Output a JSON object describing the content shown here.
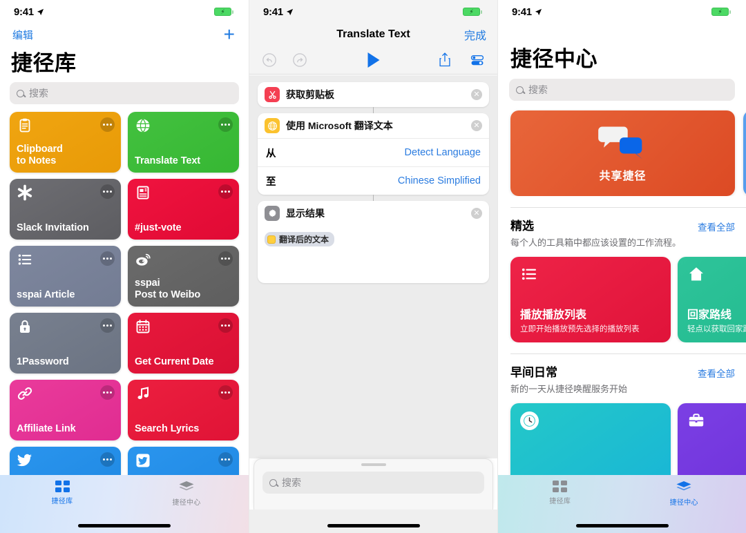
{
  "status_bar": {
    "time": "9:41",
    "location_icon": "location-arrow-icon",
    "battery_icon": "battery-charging-icon"
  },
  "panel1": {
    "nav": {
      "edit_label": "编辑",
      "add_icon": "plus-icon"
    },
    "title": "捷径库",
    "search": {
      "placeholder": "搜索",
      "icon": "search-icon"
    },
    "tiles": [
      {
        "name": "Clipboard\nto Notes",
        "icon": "clipboard-icon",
        "color": "#f0a511",
        "color2": "#e89a07",
        "dots": "more-icon"
      },
      {
        "name": "Translate Text",
        "icon": "globe-icon",
        "color": "#43c13f",
        "color2": "#36b733",
        "dots": "more-icon"
      },
      {
        "name": "Slack Invitation",
        "icon": "asterisk-icon",
        "color": "#6e6e73",
        "color2": "#5d5d61",
        "dots": "more-icon"
      },
      {
        "name": "#just-vote",
        "icon": "news-icon",
        "color": "#f0133f",
        "color2": "#e00a34",
        "dots": "more-icon"
      },
      {
        "name": "sspai Article",
        "icon": "list-icon",
        "color": "#7e879e",
        "color2": "#737c93",
        "dots": "more-icon"
      },
      {
        "name": "sspai\nPost to Weibo",
        "icon": "weibo-icon",
        "color": "#6b6b6b",
        "color2": "#5e5e5e",
        "dots": "more-icon"
      },
      {
        "name": "1Password",
        "icon": "lock-icon",
        "color": "#78808f",
        "color2": "#6b7382",
        "dots": "more-icon"
      },
      {
        "name": "Get Current Date",
        "icon": "calendar-icon",
        "color": "#e8193c",
        "color2": "#d91034",
        "dots": "more-icon"
      },
      {
        "name": "Affiliate Link",
        "icon": "link-icon",
        "color": "#ea3b9b",
        "color2": "#e02c91",
        "dots": "more-icon"
      },
      {
        "name": "Search Lyrics",
        "icon": "music-note-icon",
        "color": "#ec1f3f",
        "color2": "#e01336",
        "dots": "more-icon"
      },
      {
        "name": "",
        "icon": "twitter-bird-icon",
        "color": "#2a95ee",
        "color2": "#1f88e2",
        "dots": "more-icon"
      },
      {
        "name": "",
        "icon": "twitter-square-icon",
        "color": "#2a95ee",
        "color2": "#1f88e2",
        "dots": "more-icon"
      }
    ],
    "tabs": [
      {
        "label": "捷径库",
        "icon": "grid-icon",
        "active": true
      },
      {
        "label": "捷径中心",
        "icon": "layers-icon",
        "active": false
      }
    ]
  },
  "panel2": {
    "nav": {
      "title": "Translate Text",
      "done_label": "完成"
    },
    "toolbar": {
      "undo_icon": "undo-icon",
      "redo_icon": "redo-icon",
      "run_icon": "play-icon",
      "share_icon": "share-icon",
      "settings_icon": "sliders-icon"
    },
    "actions": [
      {
        "title": "获取剪贴板",
        "icon": "scissors-icon",
        "icon_color": "#f43f52",
        "remove_icon": "close-icon",
        "rows": []
      },
      {
        "title": "使用 Microsoft 翻译文本",
        "icon": "globe-icon",
        "icon_color": "#fbc22e",
        "remove_icon": "close-icon",
        "rows": [
          {
            "label": "从",
            "value": "Detect Language"
          },
          {
            "label": "至",
            "value": "Chinese Simplified"
          }
        ]
      },
      {
        "title": "显示结果",
        "icon": "gear-icon",
        "icon_color": "#8e8e93",
        "remove_icon": "close-icon",
        "token": "翻译后的文本",
        "rows": []
      }
    ],
    "sheet_search": {
      "placeholder": "搜索",
      "icon": "search-icon"
    }
  },
  "panel3": {
    "title": "捷径中心",
    "search": {
      "placeholder": "搜索",
      "icon": "search-icon"
    },
    "banners": [
      {
        "label": "共享捷径",
        "icon": "speech-bubbles-icon",
        "color": "#e8663a",
        "color2": "#dc4a24"
      },
      {
        "label": "",
        "icon": "",
        "color": "#5aa0ee",
        "color2": "#4b93e6"
      }
    ],
    "sections": [
      {
        "title": "精选",
        "see_all": "查看全部",
        "subtitle": "每个人的工具箱中都应该设置的工作流程。",
        "cards": [
          {
            "title": "播放播放列表",
            "subtitle": "立即开始播放预先选择的播放列表",
            "icon": "list-icon",
            "color": "#ee2347",
            "color2": "#e0133a"
          },
          {
            "title": "回家路线",
            "subtitle": "轻点以获取回家路线",
            "icon": "home-icon",
            "color": "#2ec49a",
            "color2": "#21b88d"
          }
        ]
      },
      {
        "title": "早间日常",
        "see_all": "查看全部",
        "subtitle": "新的一天从捷径唤醒服务开始",
        "cards": [
          {
            "title": "",
            "subtitle": "",
            "icon": "clock-icon",
            "color": "#24c8c8",
            "color2": "#19b6d6"
          },
          {
            "title": "",
            "subtitle": "",
            "icon": "briefcase-icon",
            "color": "#7b3fe4",
            "color2": "#6c2fd8"
          }
        ]
      }
    ],
    "tabs": [
      {
        "label": "捷径库",
        "icon": "grid-icon",
        "active": false
      },
      {
        "label": "捷径中心",
        "icon": "layers-icon",
        "active": true
      }
    ]
  }
}
